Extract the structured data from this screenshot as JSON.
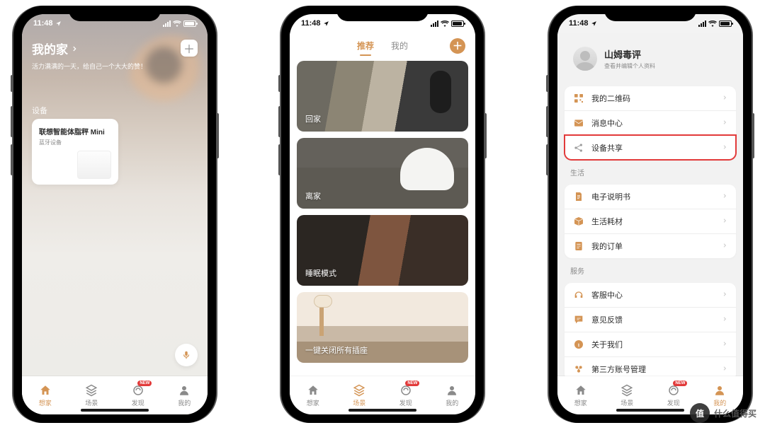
{
  "status_time": "11:48",
  "tabbar": {
    "items": [
      "想家",
      "场景",
      "发现",
      "我的"
    ],
    "badge": "NEW"
  },
  "screen1": {
    "title": "我的家",
    "subtitle": "活力满满的一天，给自己一个大大的赞！",
    "section_label": "设备",
    "device_card": {
      "title": "联想智能体脂秤 Mini",
      "subtitle": "蓝牙设备"
    },
    "active_tab_index": 0
  },
  "screen2": {
    "header_tabs": [
      "推荐",
      "我的"
    ],
    "active_header_tab_index": 0,
    "scenes": [
      "回家",
      "离家",
      "睡眠模式",
      "一键关闭所有插座"
    ],
    "active_tab_index": 1
  },
  "screen3": {
    "profile": {
      "name": "山姆毒评",
      "hint": "查看并编辑个人资料"
    },
    "group1": [
      {
        "icon": "qr-icon",
        "label": "我的二维码",
        "color": "#d49454"
      },
      {
        "icon": "mail-icon",
        "label": "消息中心",
        "color": "#d49454"
      },
      {
        "icon": "share-icon",
        "label": "设备共享",
        "color": "#9e9e9e",
        "highlight": true
      }
    ],
    "section_life": "生活",
    "group2": [
      {
        "icon": "doc-icon",
        "label": "电子说明书",
        "color": "#d49454"
      },
      {
        "icon": "box-icon",
        "label": "生活耗材",
        "color": "#d49454"
      },
      {
        "icon": "order-icon",
        "label": "我的订单",
        "color": "#d49454"
      }
    ],
    "section_service": "服务",
    "group3": [
      {
        "icon": "headset-icon",
        "label": "客服中心",
        "color": "#d49454"
      },
      {
        "icon": "feedback-icon",
        "label": "意见反馈",
        "color": "#d49454"
      },
      {
        "icon": "info-icon",
        "label": "关于我们",
        "color": "#d49454"
      },
      {
        "icon": "thirdparty-icon",
        "label": "第三方账号管理",
        "color": "#d49454"
      }
    ],
    "active_tab_index": 3
  },
  "watermark": {
    "badge": "值",
    "text": "什么值得买"
  }
}
